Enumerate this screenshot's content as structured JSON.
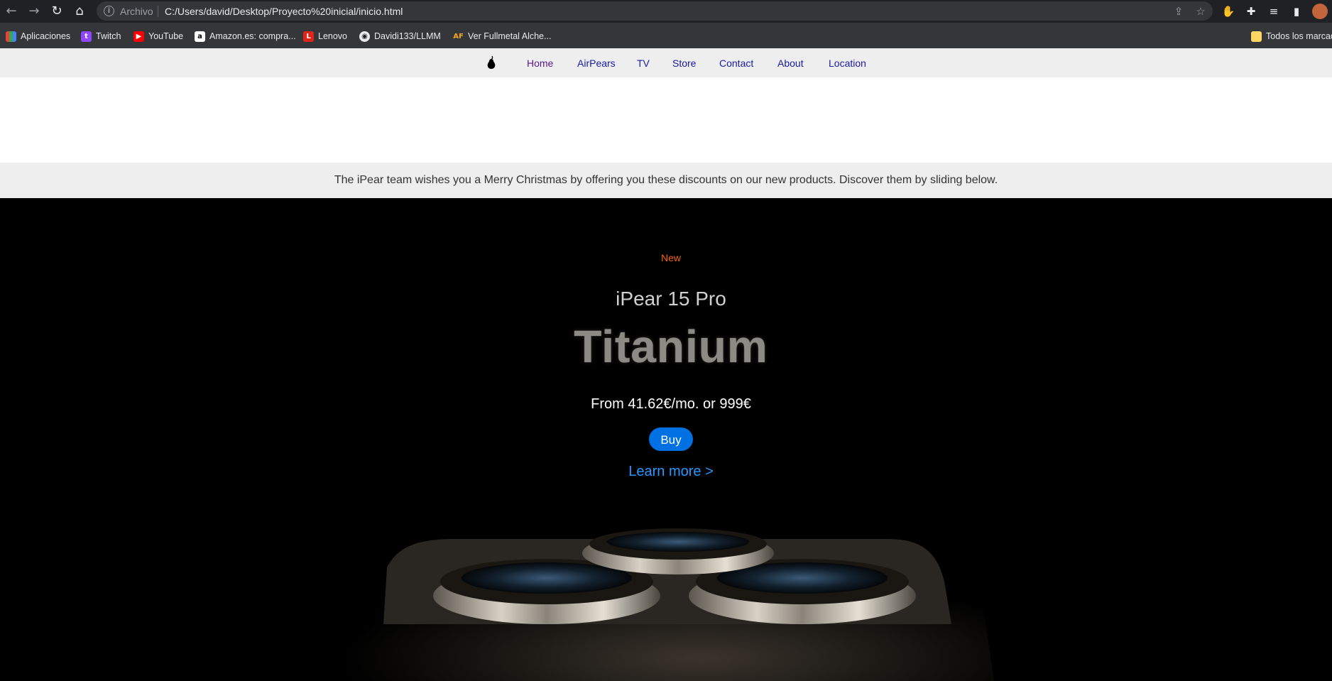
{
  "browser": {
    "omnibox_label": "Archivo",
    "url": "C:/Users/david/Desktop/Proyecto%20inicial/inicio.html",
    "bookmarks": [
      {
        "label": "Aplicaciones",
        "icon": "apps-grid-icon"
      },
      {
        "label": "Twitch",
        "icon": "twitch-icon"
      },
      {
        "label": "YouTube",
        "icon": "youtube-icon"
      },
      {
        "label": "Amazon.es: compra...",
        "icon": "amazon-icon"
      },
      {
        "label": "Lenovo",
        "icon": "lenovo-icon"
      },
      {
        "label": "Davidi133/LLMM",
        "icon": "github-icon"
      },
      {
        "label": "Ver Fullmetal Alche...",
        "icon": "af-icon"
      },
      {
        "label": "Todos los marcad",
        "icon": "folder-icon"
      }
    ]
  },
  "nav": {
    "items": [
      {
        "label": "Home"
      },
      {
        "label": "AirPears"
      },
      {
        "label": "TV"
      },
      {
        "label": "Store"
      },
      {
        "label": "Contact"
      },
      {
        "label": "About"
      },
      {
        "label": "Location"
      }
    ]
  },
  "banner": {
    "text": "The iPear team wishes you a Merry Christmas by offering you these discounts on our new products. Discover them by sliding below."
  },
  "hero": {
    "badge": "New",
    "title": "iPear 15 Pro",
    "subtitle": "Titanium",
    "price": "From 41.62€/mo. or 999€",
    "buy_label": "Buy",
    "learn_more": "Learn more >"
  },
  "colors": {
    "badge": "#f56300",
    "buy": "#0071e3",
    "link": "#2997ff",
    "nav_link": "#1a1aa6"
  }
}
